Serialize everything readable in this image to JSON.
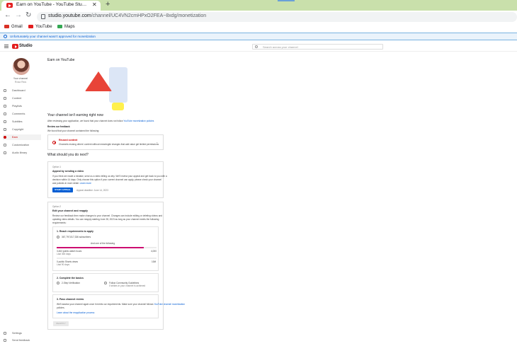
{
  "browser": {
    "tab_title": "Earn on YouTube - YouTube Stu…",
    "close_label": "✕",
    "new_tab_label": "+",
    "url_host": "studio.youtube.com",
    "url_path": "/channel/UC4VN2cmHPxO2FEA~8xdg/monetization",
    "bookmarks": [
      {
        "label": "Gmail",
        "color": "#d93025"
      },
      {
        "label": "YouTube",
        "color": "#e31e1e"
      },
      {
        "label": "Maps",
        "color": "#34a853"
      }
    ]
  },
  "banner": {
    "text": "Unfortunately your channel wasn't approved for monetization"
  },
  "studio": {
    "logo_text": "Studio",
    "search_placeholder": "Search across your channel"
  },
  "sidebar": {
    "channel_label": "Your channel",
    "channel_name": "Rosa Rios",
    "items": [
      {
        "label": "Dashboard"
      },
      {
        "label": "Content"
      },
      {
        "label": "Playlists"
      },
      {
        "label": "Comments"
      },
      {
        "label": "Subtitles"
      },
      {
        "label": "Copyright"
      },
      {
        "label": "Earn",
        "active": true
      },
      {
        "label": "Customization"
      },
      {
        "label": "Audio library"
      }
    ],
    "bottom_items": [
      {
        "label": "Settings"
      },
      {
        "label": "Send feedback"
      }
    ]
  },
  "main": {
    "title": "Earn on YouTube",
    "status_title": "Your channel isn't earning right now",
    "status_desc_pre": "After reviewing your application, we found that your channel does not follow ",
    "status_desc_link": "YouTube monetization policies",
    "review_heading": "Review our feedback",
    "review_desc": "We found that your channel contained the following:",
    "feedback_title": "Reused content",
    "feedback_desc": "Channels reusing others' content without meaningful changes that add value get limited permissions",
    "next_heading": "What should you do next?",
    "option1": {
      "label": "Option 1",
      "title": "Appeal by sending a video",
      "desc1": "If you think we made a mistake, send us a video telling us why. We'll review your appeal and get back to you with a",
      "desc2": "decision within 14 days. Only choose this option if your current channel can apply, please check your channel",
      "desc3": "and policies in more detail. ",
      "desc_link": "Learn more",
      "button": "START APPEAL",
      "deadline": "Appeal deadline: June 14, 2023"
    },
    "option2": {
      "label": "Option 2",
      "title": "Edit your channel and reapply",
      "desc1": "Review our feedback then make changes to your channel. Changes can include editing or deleting videos and",
      "desc2": "updating video details. You can reapply starting June 28, 2023 as long as your channel meets the following",
      "desc3": "requirements:",
      "step1_title": "1. Reach requirements to apply",
      "subs_label": "367,797,817,336 subscribers",
      "and_one": "And one of the following",
      "watch_hours_label": "3,463 public watch hours",
      "watch_hours_sub": "Last 365 days",
      "watch_hours_target": "4,000",
      "watch_hours_progress": 0.87,
      "shorts_label": "0 public Shorts views",
      "shorts_sub": "Last 90 days",
      "shorts_target": "10M",
      "shorts_progress": 0,
      "step2_title": "2. Complete the basics",
      "twostep_label": "2-Step Verification",
      "guidelines_label": "Follow Community Guidelines",
      "guidelines_sub": "0 strikes in your channel is achieved",
      "step3_title": "3. Pass channel review",
      "step3_desc1": "We'll assess your channel again once it meets our requirements. Make sure your channel follows ",
      "step3_link": "YouTube channel monetization",
      "step3_desc2": "policies.",
      "step3_learn": "Learn about the reapplication process",
      "reapply_button": "REAPPLY"
    }
  }
}
